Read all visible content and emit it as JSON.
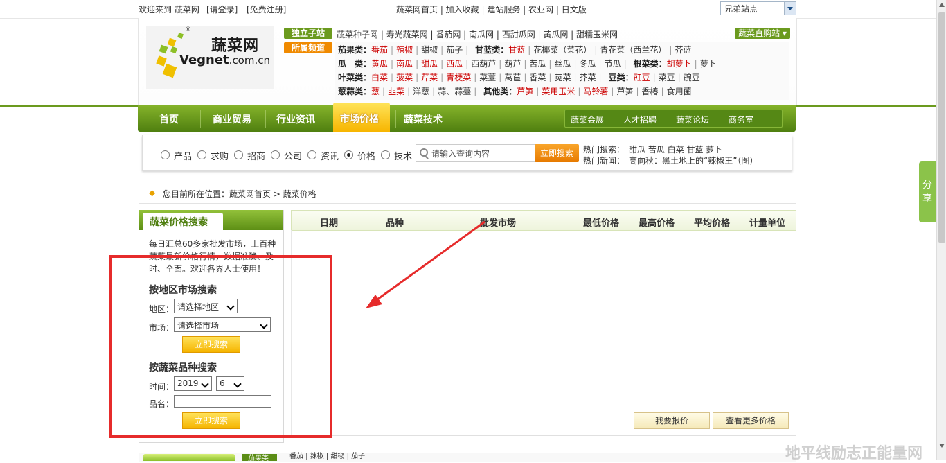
{
  "topbar": {
    "welcome": "欢迎来到 蔬菜网",
    "login": "[请登录]",
    "register": "[免费注册]",
    "links": "蔬菜网首页 | 加入收藏 | 建站服务 | 农业网 | 日文版",
    "site_select": "兄弟站点"
  },
  "logo": {
    "cn": "蔬菜网",
    "en_main": "Vegnet",
    "en_domain": ".com.cn",
    "reg": "®"
  },
  "header": {
    "tag_independent": "独立子站",
    "tag_channel": "所属频道",
    "independent_sites": "蔬菜种子网 | 寿光蔬菜网 | 番茄网 | 南瓜网 | 西甜瓜网 | 黄瓜网 | 甜糯玉米网",
    "zhigou": "蔬菜直购站",
    "row1": {
      "label1": "茄果类：",
      "items1": [
        [
          "番茄",
          "red"
        ],
        [
          "辣椒",
          "red"
        ],
        [
          "甜椒",
          ""
        ],
        [
          "茄子",
          ""
        ]
      ],
      "label2": "甘蓝类：",
      "items2": [
        [
          "甘蓝",
          "red"
        ],
        [
          "花椰菜（菜花）",
          ""
        ],
        [
          "青花菜（西兰花）",
          ""
        ],
        [
          "芥蓝",
          ""
        ]
      ]
    },
    "row2": {
      "label1": "瓜　类：",
      "items1": [
        [
          "黄瓜",
          "red"
        ],
        [
          "南瓜",
          "red"
        ],
        [
          "甜瓜",
          "red"
        ],
        [
          "西瓜",
          "red"
        ],
        [
          "西葫芦",
          ""
        ],
        [
          "葫芦",
          ""
        ],
        [
          "苦瓜",
          ""
        ],
        [
          "丝瓜",
          ""
        ],
        [
          "冬瓜",
          ""
        ],
        [
          "节瓜",
          ""
        ]
      ],
      "label2": "根菜类：",
      "items2": [
        [
          "胡萝卜",
          "red"
        ],
        [
          "萝卜",
          ""
        ]
      ]
    },
    "row3": {
      "label1": "叶菜类：",
      "items1": [
        [
          "白菜",
          "red"
        ],
        [
          "菠菜",
          "red"
        ],
        [
          "芹菜",
          "red"
        ],
        [
          "青梗菜",
          "red"
        ],
        [
          "菜薹",
          ""
        ],
        [
          "莴苣",
          ""
        ],
        [
          "香菜",
          ""
        ],
        [
          "苋菜",
          ""
        ],
        [
          "芥菜",
          ""
        ]
      ],
      "label2": "豆类：",
      "items2": [
        [
          "豇豆",
          "red"
        ],
        [
          "菜豆",
          ""
        ],
        [
          "豌豆",
          ""
        ]
      ]
    },
    "row4": {
      "label1": "葱蒜类：",
      "items1": [
        [
          "葱",
          "red"
        ],
        [
          "韭菜",
          "red"
        ],
        [
          "洋葱",
          ""
        ],
        [
          "蒜、蒜薹",
          ""
        ]
      ],
      "label2": "其他类：",
      "items2": [
        [
          "芦笋",
          "red"
        ],
        [
          "菜用玉米",
          "red"
        ],
        [
          "马铃薯",
          "red"
        ],
        [
          "芦笋",
          ""
        ],
        [
          "香椿",
          ""
        ],
        [
          "食用菌",
          ""
        ]
      ]
    }
  },
  "nav": {
    "items": [
      "首页",
      "商业贸易",
      "行业资讯",
      "市场价格",
      "蔬菜技术"
    ],
    "sub": [
      "蔬菜会展",
      "人才招聘",
      "蔬菜论坛",
      "商务室"
    ]
  },
  "search": {
    "options": [
      "产品",
      "求购",
      "招商",
      "公司",
      "资讯",
      "价格",
      "技术"
    ],
    "selected": "价格",
    "placeholder": "请输入查询内容",
    "button": "立即搜索",
    "hot_search_label": "热门搜索：",
    "hot_search": "甜瓜  苦瓜  白菜  甘蓝  萝卜",
    "hot_news_label": "热门新闻：",
    "hot_news": "高向秋：黑土地上的“辣椒王”（图）"
  },
  "breadcrumb": "您目前所在位置：蔬菜网首页 > 蔬菜价格",
  "left": {
    "title": "蔬菜价格搜索",
    "intro": [
      "每日汇总60多家批发市场，上百种",
      "蔬菜最新价格行情，数据准确、及",
      "时、全面。欢迎各界人士使用！"
    ],
    "region_heading": "按地区市场搜索",
    "region_label": "地区：",
    "region_value": "请选择地区",
    "market_label": "市场：",
    "market_value": "请选择市场",
    "btn1": "立即搜索",
    "variety_heading": "按蔬菜品种搜索",
    "time_label": "时间：",
    "year": "2019",
    "month": "6",
    "name_label": "品名：",
    "btn2": "立即搜索"
  },
  "table": {
    "headers": [
      "日期",
      "品种",
      "批发市场",
      "最低价格",
      "最高价格",
      "平均价格",
      "计量单位"
    ],
    "btn_quote": "我要报价",
    "btn_more": "查看更多价格"
  },
  "share": "分享",
  "bottom_tab": "茄果类",
  "bottom_links": "番茄 | 辣椒 | 甜椒 | 茄子",
  "watermark": "地平线励志正能量网",
  "colors": {
    "nav_green": "#6b9a1e",
    "accent_orange": "#e77a00",
    "annotation_red": "#e62b2b",
    "link_red": "#cc0000"
  }
}
